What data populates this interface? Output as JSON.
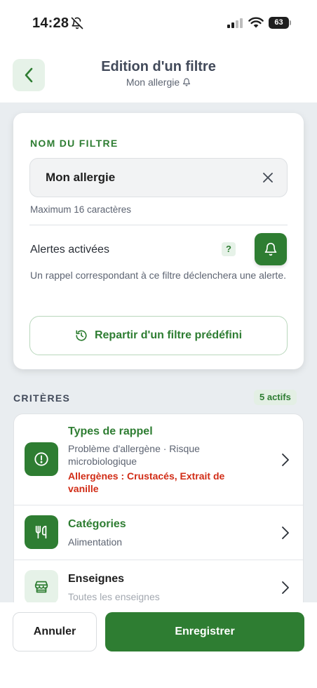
{
  "status_bar": {
    "time": "14:28",
    "battery_level": "63"
  },
  "header": {
    "title": "Edition d'un filtre",
    "subtitle": "Mon allergie"
  },
  "filter_card": {
    "section_label": "NOM DU FILTRE",
    "name_value": "Mon allergie",
    "hint": "Maximum 16 caractères",
    "alerts_label": "Alertes activées",
    "help_label": "?",
    "alerts_description": "Un rappel correspondant à ce filtre déclenchera une alerte.",
    "preset_button_label": "Repartir d'un filtre prédéfini"
  },
  "criteria": {
    "title": "CRITÈRES",
    "badge": "5 actifs",
    "items": [
      {
        "title": "Types de rappel",
        "subtitle": "Problème d'allergène · Risque microbiologique",
        "warning": "Allergènes : Crustacés, Extrait de vanille",
        "icon": "alert-circle-icon"
      },
      {
        "title": "Catégories",
        "subtitle": "Alimentation",
        "icon": "fork-knife-icon"
      },
      {
        "title": "Enseignes",
        "subtitle": "Toutes les enseignes",
        "icon": "store-icon"
      }
    ]
  },
  "footer": {
    "cancel_label": "Annuler",
    "save_label": "Enregistrer"
  },
  "colors": {
    "brand_green": "#2e7d32",
    "light_green": "#e6f2e8",
    "warning_red": "#d12c16",
    "background_gray": "#e9edf0"
  }
}
